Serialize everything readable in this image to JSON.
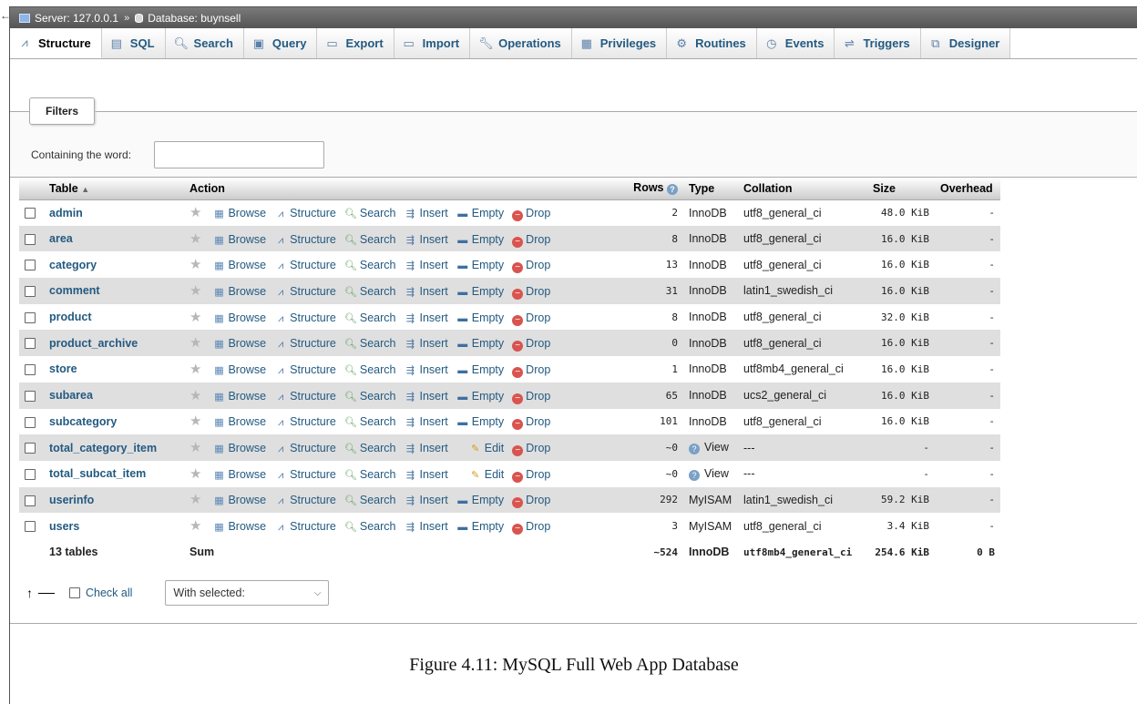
{
  "breadcrumb": {
    "server": "Server: 127.0.0.1",
    "separator": "»",
    "database": "Database: buynsell"
  },
  "tabs": [
    {
      "label": "Structure",
      "icon": "structure-icon",
      "active": true
    },
    {
      "label": "SQL",
      "icon": "sql-icon"
    },
    {
      "label": "Search",
      "icon": "search-icon"
    },
    {
      "label": "Query",
      "icon": "query-icon"
    },
    {
      "label": "Export",
      "icon": "export-icon"
    },
    {
      "label": "Import",
      "icon": "import-icon"
    },
    {
      "label": "Operations",
      "icon": "wrench-icon"
    },
    {
      "label": "Privileges",
      "icon": "privileges-icon"
    },
    {
      "label": "Routines",
      "icon": "routines-icon"
    },
    {
      "label": "Events",
      "icon": "clock-icon"
    },
    {
      "label": "Triggers",
      "icon": "triggers-icon"
    },
    {
      "label": "Designer",
      "icon": "designer-icon"
    }
  ],
  "filters": {
    "legend": "Filters",
    "label": "Containing the word:",
    "value": ""
  },
  "columns": {
    "table": "Table",
    "action": "Action",
    "rows": "Rows",
    "type": "Type",
    "collation": "Collation",
    "size": "Size",
    "overhead": "Overhead"
  },
  "actions": {
    "browse": "Browse",
    "structure": "Structure",
    "search": "Search",
    "insert": "Insert",
    "empty": "Empty",
    "edit": "Edit",
    "drop": "Drop"
  },
  "rows": [
    {
      "name": "admin",
      "rows": "2",
      "type": "InnoDB",
      "collation": "utf8_general_ci",
      "size": "48.0 KiB",
      "overhead": "-",
      "view": false
    },
    {
      "name": "area",
      "rows": "8",
      "type": "InnoDB",
      "collation": "utf8_general_ci",
      "size": "16.0 KiB",
      "overhead": "-",
      "view": false
    },
    {
      "name": "category",
      "rows": "13",
      "type": "InnoDB",
      "collation": "utf8_general_ci",
      "size": "16.0 KiB",
      "overhead": "-",
      "view": false
    },
    {
      "name": "comment",
      "rows": "31",
      "type": "InnoDB",
      "collation": "latin1_swedish_ci",
      "size": "16.0 KiB",
      "overhead": "-",
      "view": false
    },
    {
      "name": "product",
      "rows": "8",
      "type": "InnoDB",
      "collation": "utf8_general_ci",
      "size": "32.0 KiB",
      "overhead": "-",
      "view": false
    },
    {
      "name": "product_archive",
      "rows": "0",
      "type": "InnoDB",
      "collation": "utf8_general_ci",
      "size": "16.0 KiB",
      "overhead": "-",
      "view": false
    },
    {
      "name": "store",
      "rows": "1",
      "type": "InnoDB",
      "collation": "utf8mb4_general_ci",
      "size": "16.0 KiB",
      "overhead": "-",
      "view": false
    },
    {
      "name": "subarea",
      "rows": "65",
      "type": "InnoDB",
      "collation": "ucs2_general_ci",
      "size": "16.0 KiB",
      "overhead": "-",
      "view": false
    },
    {
      "name": "subcategory",
      "rows": "101",
      "type": "InnoDB",
      "collation": "utf8_general_ci",
      "size": "16.0 KiB",
      "overhead": "-",
      "view": false
    },
    {
      "name": "total_category_item",
      "rows": "~0",
      "type": "View",
      "collation": "---",
      "size": "-",
      "overhead": "-",
      "view": true
    },
    {
      "name": "total_subcat_item",
      "rows": "~0",
      "type": "View",
      "collation": "---",
      "size": "-",
      "overhead": "-",
      "view": true
    },
    {
      "name": "userinfo",
      "rows": "292",
      "type": "MyISAM",
      "collation": "latin1_swedish_ci",
      "size": "59.2 KiB",
      "overhead": "-",
      "view": false
    },
    {
      "name": "users",
      "rows": "3",
      "type": "MyISAM",
      "collation": "utf8_general_ci",
      "size": "3.4 KiB",
      "overhead": "-",
      "view": false
    }
  ],
  "summary": {
    "count": "13 tables",
    "label": "Sum",
    "rows": "~524",
    "type": "InnoDB",
    "collation": "utf8mb4_general_ci",
    "size": "254.6 KiB",
    "overhead": "0 B"
  },
  "bottom": {
    "check_all": "Check all",
    "with_selected": "With selected:"
  },
  "caption": "Figure 4.11: MySQL Full Web App Database"
}
